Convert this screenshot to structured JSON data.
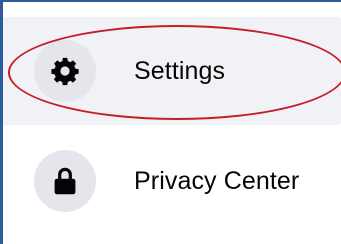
{
  "menu": {
    "items": [
      {
        "label": "Settings",
        "icon": "gear-icon",
        "active": true
      },
      {
        "label": "Privacy Center",
        "icon": "lock-icon",
        "active": false
      }
    ]
  },
  "colors": {
    "frame_border": "#2f5a9c",
    "active_background": "#f0f2f5",
    "icon_circle": "#e4e6eb",
    "icon_glyph": "#050505",
    "annotation_oval": "#c61d29"
  }
}
